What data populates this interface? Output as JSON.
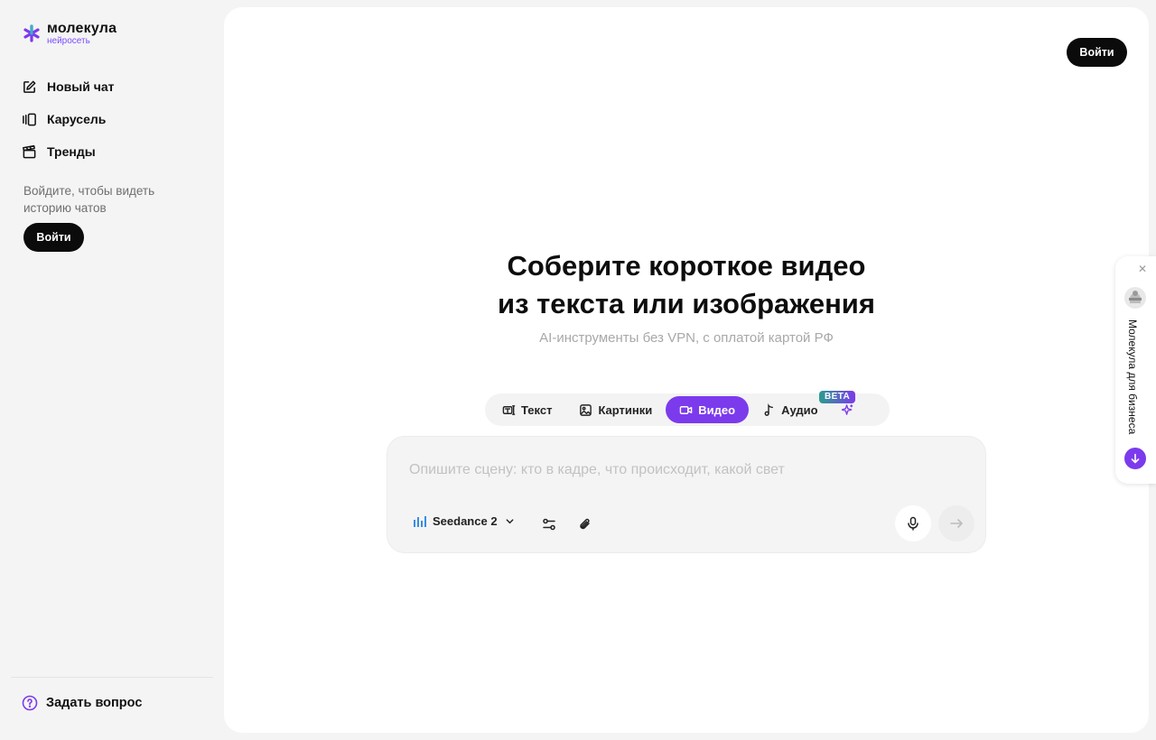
{
  "app": {
    "logo_main": "молекула",
    "logo_sub": "нейросеть"
  },
  "sidebar": {
    "items": [
      {
        "label": "Новый чат",
        "icon": "edit-icon"
      },
      {
        "label": "Карусель",
        "icon": "carousel-icon"
      },
      {
        "label": "Тренды",
        "icon": "clapperboard-icon"
      }
    ],
    "login_hint": "Войдите, чтобы видеть историю чатов",
    "login_button": "Войти",
    "ask_label": "Задать вопрос"
  },
  "header": {
    "login_button": "Войти"
  },
  "hero": {
    "title_line1": "Соберите короткое видео",
    "title_line2": "из текста или изображения",
    "subtitle": "AI-инструменты без VPN, с оплатой картой РФ"
  },
  "modes": {
    "tabs": [
      {
        "label": "Текст",
        "icon": "text-icon",
        "active": false
      },
      {
        "label": "Картинки",
        "icon": "image-icon",
        "active": false
      },
      {
        "label": "Видео",
        "icon": "video-icon",
        "active": true
      },
      {
        "label": "Аудио",
        "icon": "music-note-icon",
        "active": false
      }
    ],
    "beta_badge": "BETA",
    "accent": "#7c3aed"
  },
  "composer": {
    "placeholder": "Опишите сцену: кто в кадре, что происходит, какой свет",
    "model": "Seedance 2"
  },
  "business_widget": {
    "label": "Молекула для бизнеса"
  }
}
